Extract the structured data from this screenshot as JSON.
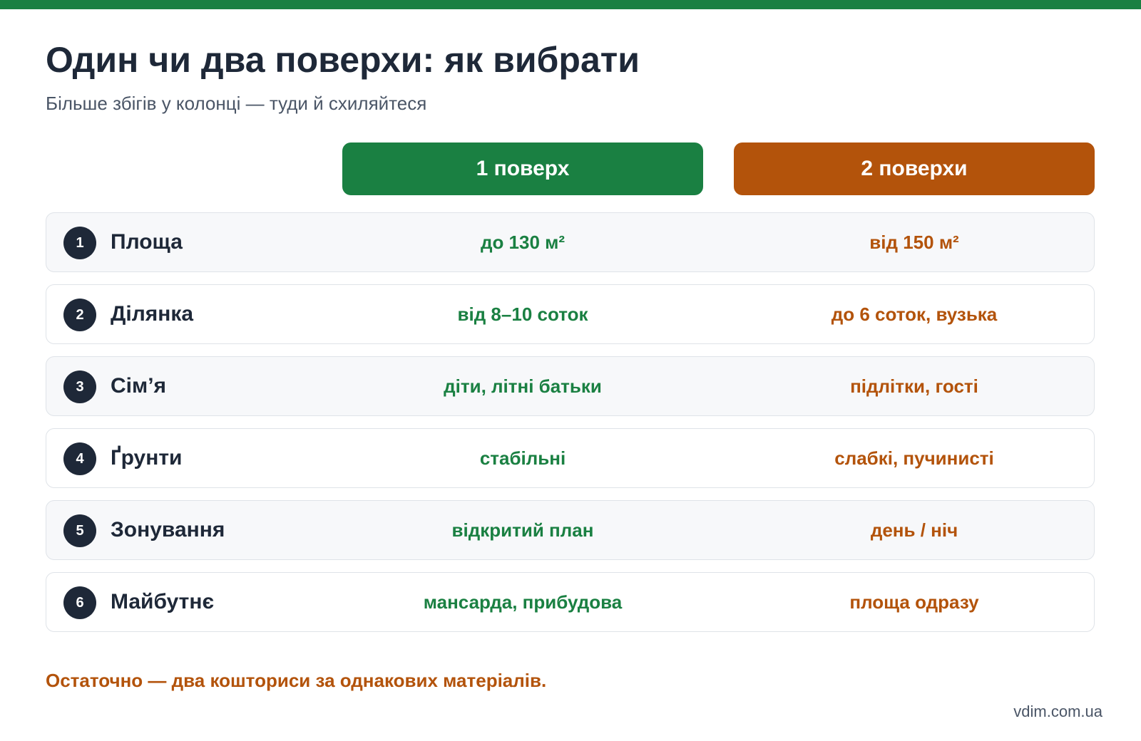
{
  "title": "Один чи два поверхи: як вибрати",
  "subtitle": "Більше збігів у колонці — туди й схиляйтеся",
  "columns": {
    "one": "1 поверх",
    "two": "2 поверхи"
  },
  "rows": [
    {
      "num": "1",
      "label": "Площа",
      "one": "до 130 м²",
      "two": "від 150 м²"
    },
    {
      "num": "2",
      "label": "Ділянка",
      "one": "від 8–10 соток",
      "two": "до 6 соток, вузька"
    },
    {
      "num": "3",
      "label": "Сім’я",
      "one": "діти, літні батьки",
      "two": "підлітки, гості"
    },
    {
      "num": "4",
      "label": "Ґрунти",
      "one": "стабільні",
      "two": "слабкі, пучинисті"
    },
    {
      "num": "5",
      "label": "Зонування",
      "one": "відкритий план",
      "two": "день / ніч"
    },
    {
      "num": "6",
      "label": "Майбутнє",
      "one": "мансарда, прибудова",
      "two": "площа одразу"
    }
  ],
  "footer_note": "Остаточно — два кошториси за однакових матеріалів.",
  "site": "vdim.com.ua",
  "colors": {
    "green": "#1a8042",
    "orange": "#b3530b",
    "dark": "#1e2838"
  }
}
